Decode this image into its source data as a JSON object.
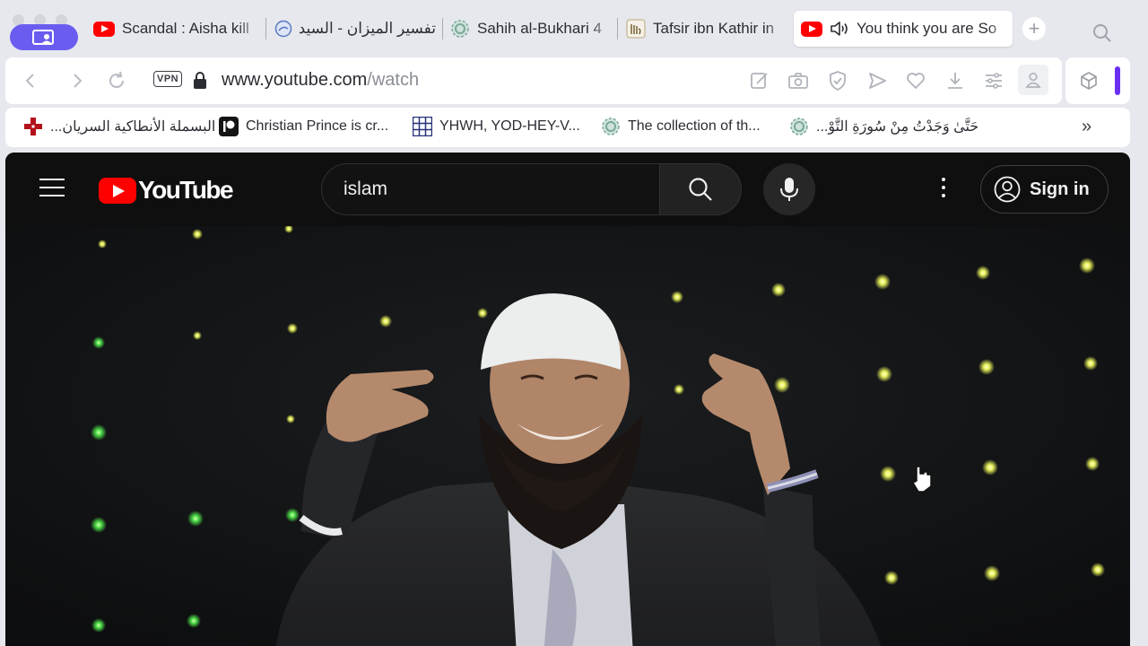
{
  "browser": {
    "tabs": [
      {
        "title": "Scandal : Aisha kill",
        "favicon": "youtube-icon",
        "active": false
      },
      {
        "title": "تفسير الميزان - السيد",
        "favicon": "globe-icon",
        "active": false
      },
      {
        "title": "Sahih al-Bukhari 4",
        "favicon": "pattern-icon",
        "active": false
      },
      {
        "title": "Tafsir ibn Kathir in",
        "favicon": "allah-calligraphy-icon",
        "active": false
      },
      {
        "title": "You think you are So",
        "favicon": "youtube-icon",
        "active": true,
        "audio": true
      }
    ],
    "address": {
      "vpn_label": "VPN",
      "url_host": "www.youtube.com",
      "url_path": "/watch"
    },
    "bookmarks": [
      {
        "label": "البسملة الأنطاكية السريان...",
        "icon": "red-cross-icon"
      },
      {
        "label": "Christian Prince is cr...",
        "icon": "patreon-icon"
      },
      {
        "label": "YHWH, YOD-HEY-V...",
        "icon": "grid-icon"
      },
      {
        "label": "The collection of th...",
        "icon": "pattern-icon"
      },
      {
        "label": "حَتَّىٰ وَجَدْتُ مِنْ سُورَةِ التَّوْ...",
        "icon": "pattern-icon"
      }
    ],
    "more_bookmarks": "»"
  },
  "youtube": {
    "logo_text": "YouTube",
    "search_value": "islam",
    "signin_label": "Sign in"
  },
  "colors": {
    "accent": "#6b5cf0",
    "youtube_red": "#ff0000",
    "youtube_bg": "#0f0f0f"
  }
}
